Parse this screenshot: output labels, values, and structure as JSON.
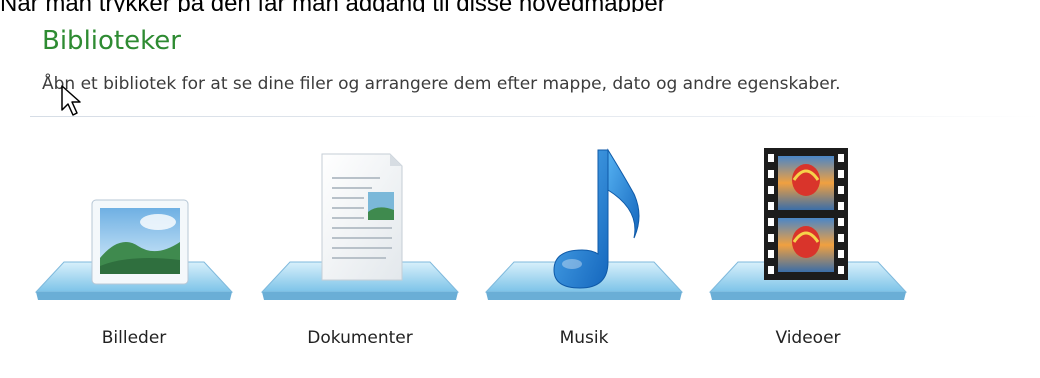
{
  "caption": "Når man trykker på den får man adgang til disse hovedmapper",
  "header": {
    "title": "Biblioteker",
    "subtitle": "Åbn et bibliotek for at se dine filer og arrangere dem efter mappe, dato og andre egenskaber."
  },
  "libraries": [
    {
      "label": "Billeder",
      "icon": "pictures-library-icon"
    },
    {
      "label": "Dokumenter",
      "icon": "documents-library-icon"
    },
    {
      "label": "Musik",
      "icon": "music-library-icon"
    },
    {
      "label": "Videoer",
      "icon": "videos-library-icon"
    }
  ],
  "colors": {
    "title": "#2e8b32",
    "platform": "#9fd3ef",
    "music_note": "#1b7bd3"
  }
}
